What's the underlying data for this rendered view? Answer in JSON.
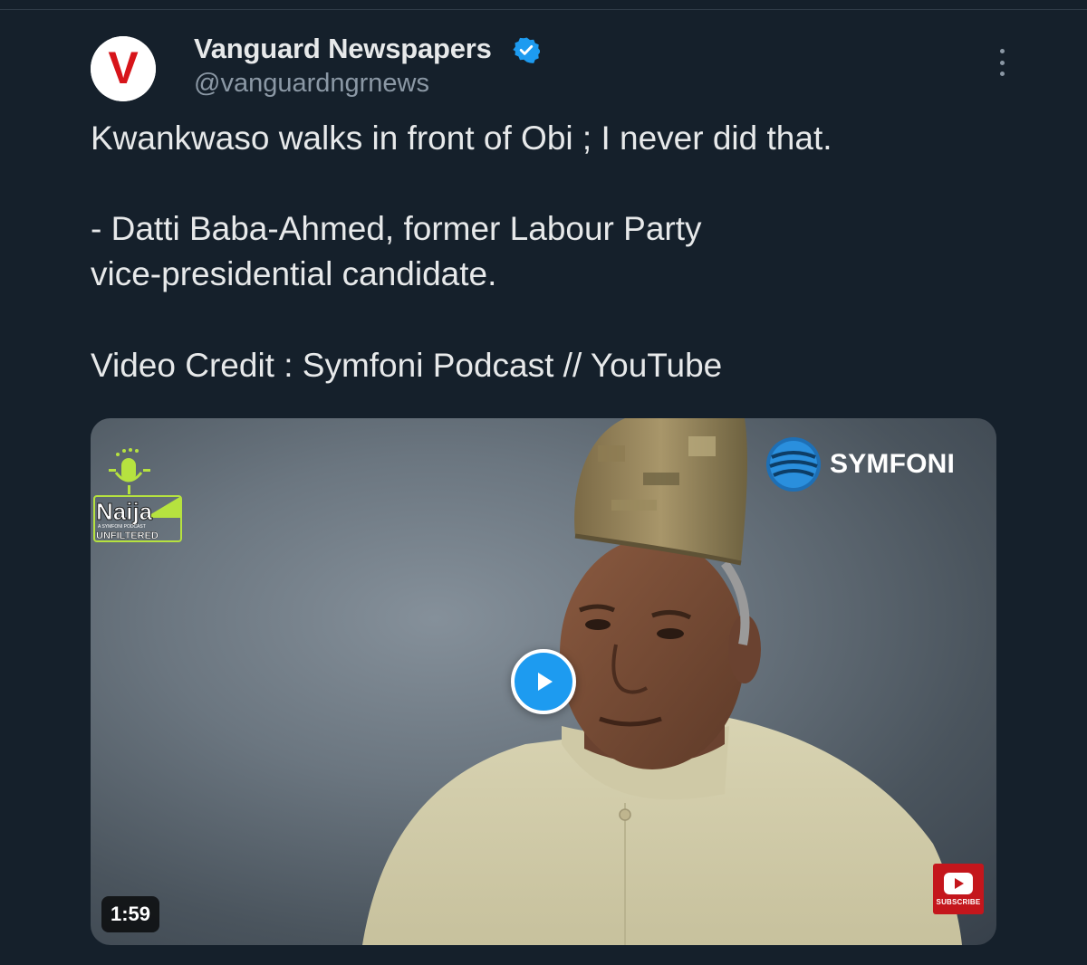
{
  "author": {
    "name": "Vanguard Newspapers",
    "handle": "@vanguardngrnews",
    "avatar_letter": "V",
    "verified": true
  },
  "tweet": {
    "lines": [
      "Kwankwaso walks in front of Obi ; I never did that.",
      "- Datti Baba-Ahmed, former Labour Party",
      "vice-presidential candidate.",
      "Video Credit : Symfoni Podcast // YouTube"
    ]
  },
  "media": {
    "duration": "1:59",
    "watermark_right": "SYMFONI",
    "watermark_left_title": "Naija",
    "watermark_left_tagline": "A SYMFONI PODCAST",
    "watermark_left_subtitle": "UNFILTERED",
    "subscribe_label": "SUBSCRIBE"
  },
  "colors": {
    "background": "#15202b",
    "text_primary": "#e7e9ea",
    "text_secondary": "#8b98a5",
    "accent": "#1d9bf0",
    "brand_red": "#d7141a",
    "naija_green": "#b6e23f"
  },
  "icons": {
    "verified": "verified-badge-icon",
    "more": "more-options-icon",
    "play": "play-icon",
    "subscribe": "youtube-subscribe-icon"
  }
}
